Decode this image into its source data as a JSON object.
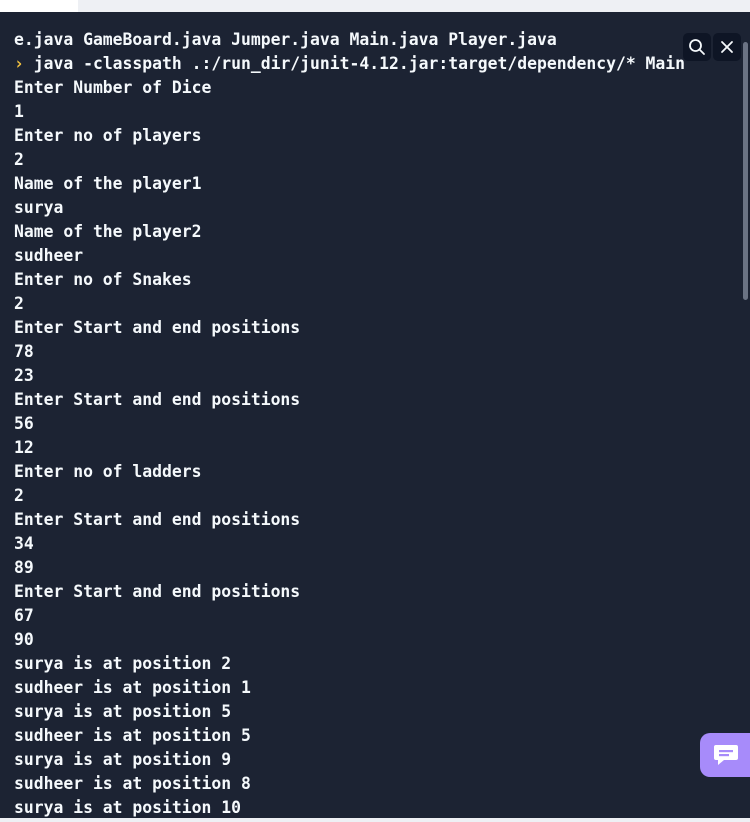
{
  "terminal": {
    "header_line": "e.java GameBoard.java Jumper.java Main.java Player.java",
    "prompt_symbol": "›",
    "command": " java -classpath .:/run_dir/junit-4.12.jar:target/dependency/* Main",
    "output": [
      "Enter Number of Dice",
      "1",
      "Enter no of players",
      "2",
      "Name of the player1",
      "surya",
      "Name of the player2",
      "sudheer",
      "Enter no of Snakes",
      "2",
      "Enter Start and end positions",
      "78",
      "23",
      "Enter Start and end positions",
      "56",
      "12",
      "Enter no of ladders",
      "2",
      "Enter Start and end positions",
      "34",
      "89",
      "Enter Start and end positions",
      "67",
      "90",
      "surya is at position 2",
      "sudheer is at position 1",
      "surya is at position 5",
      "sudheer is at position 5",
      "surya is at position 9",
      "sudheer is at position 8",
      "surya is at position 10"
    ],
    "actions": {
      "search_icon": "search-icon",
      "close_icon": "close-icon"
    }
  },
  "chat_button": {
    "icon": "chat-bubble-icon"
  },
  "colors": {
    "background": "#1c2333",
    "text": "#f5f9fc",
    "prompt": "#f0c040",
    "chat_accent": "#a78bfa",
    "scrollbar": "#6b7384"
  }
}
